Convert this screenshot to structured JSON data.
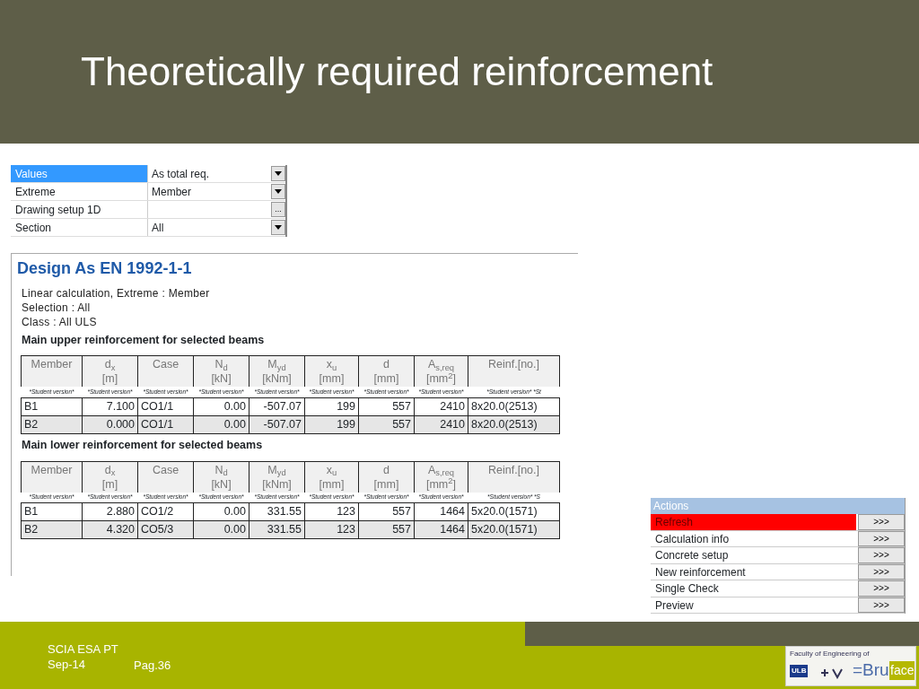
{
  "slide": {
    "title": "Theoretically required reinforcement"
  },
  "property_grid": [
    {
      "label": "Values",
      "value": "As total req.",
      "kind": "dropdown",
      "selected": true
    },
    {
      "label": "Extreme",
      "value": "Member",
      "kind": "dropdown",
      "selected": false
    },
    {
      "label": "Drawing setup 1D",
      "kind": "ellipsis",
      "button": "...",
      "selected": false
    },
    {
      "label": "Section",
      "value": "All",
      "kind": "dropdown",
      "selected": false
    }
  ],
  "report": {
    "title": "Design As EN 1992-1-1",
    "info": [
      "Linear calculation,  Extreme : Member",
      "Selection  : All",
      "Class  : All ULS"
    ],
    "tables": [
      {
        "heading": "Main upper reinforcement for selected beams",
        "columns": [
          {
            "name": "Member"
          },
          {
            "name": "d$_{x}$",
            "unit": "[m]"
          },
          {
            "name": "Case"
          },
          {
            "name": "N$_{d}$",
            "unit": "[kN]"
          },
          {
            "name": "M$_{yd}$",
            "unit": "[kNm]"
          },
          {
            "name": "x$_{u}$",
            "unit": "[mm]"
          },
          {
            "name": "d",
            "unit": "[mm]"
          },
          {
            "name": "A$_{s,req}$",
            "unit": "[mm$^{2}$]"
          },
          {
            "name": "Reinf.[no.]"
          }
        ],
        "watermark": [
          "*Student version*",
          "*Student version*",
          "*Student version*",
          "*Student version*",
          "*Student version*",
          "*Student version*",
          "*Student version*",
          "*Student version*",
          "*Student version*  *St"
        ],
        "rows": [
          [
            "B1",
            "7.100",
            "CO1/1",
            "0.00",
            "-507.07",
            "199",
            "557",
            "2410",
            "8x20.0(2513)"
          ],
          [
            "B2",
            "0.000",
            "CO1/1",
            "0.00",
            "-507.07",
            "199",
            "557",
            "2410",
            "8x20.0(2513)"
          ]
        ]
      },
      {
        "heading": "Main lower reinforcement for selected beams",
        "columns": [
          {
            "name": "Member"
          },
          {
            "name": "d$_{x}$",
            "unit": "[m]"
          },
          {
            "name": "Case"
          },
          {
            "name": "N$_{d}$",
            "unit": "[kN]"
          },
          {
            "name": "M$_{yd}$",
            "unit": "[kNm]"
          },
          {
            "name": "x$_{u}$",
            "unit": "[mm]"
          },
          {
            "name": "d",
            "unit": "[mm]"
          },
          {
            "name": "A$_{s,req}$",
            "unit": "[mm$^{2}$]"
          },
          {
            "name": "Reinf.[no.]"
          }
        ],
        "watermark": [
          "*Student version*",
          "*Student version*",
          "*Student version*",
          "*Student version*",
          "*Student version*",
          "*Student version*",
          "*Student version*",
          "*Student version*",
          "*Student version*  *S"
        ],
        "rows": [
          [
            "B1",
            "2.880",
            "CO1/2",
            "0.00",
            "331.55",
            "123",
            "557",
            "1464",
            "5x20.0(1571)"
          ],
          [
            "B2",
            "4.320",
            "CO5/3",
            "0.00",
            "331.55",
            "123",
            "557",
            "1464",
            "5x20.0(1571)"
          ]
        ]
      }
    ]
  },
  "actions": {
    "title": "Actions",
    "items": [
      {
        "label": "Refresh",
        "button": ">>>",
        "selected": true
      },
      {
        "label": "Calculation info",
        "button": ">>>",
        "selected": false
      },
      {
        "label": "Concrete setup",
        "button": ">>>",
        "selected": false
      },
      {
        "label": "New reinforcement",
        "button": ">>>",
        "selected": false
      },
      {
        "label": "Single Check",
        "button": ">>>",
        "selected": false
      },
      {
        "label": "Preview",
        "button": ">>>",
        "selected": false
      }
    ]
  },
  "footer": {
    "lines": [
      "SCIA ESA PT",
      "Sep-14"
    ],
    "page": "Pag.36",
    "logo": {
      "caption": "Faculty of Engineering of",
      "mark": "ULB",
      "word": "=Bru",
      "suffix": "face"
    }
  }
}
